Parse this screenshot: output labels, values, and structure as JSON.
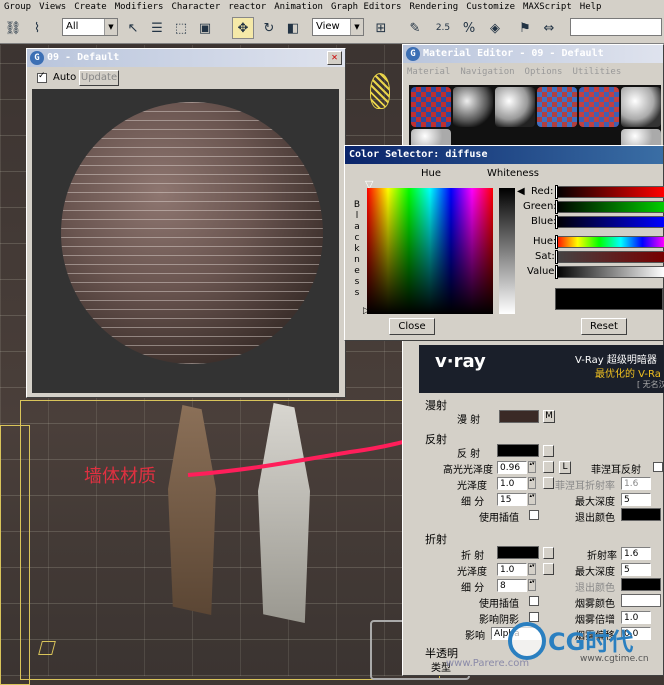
{
  "menubar": {
    "items": [
      "Group",
      "Views",
      "Create",
      "Modifiers",
      "Character",
      "reactor",
      "Animation",
      "Graph Editors",
      "Rendering",
      "Customize",
      "MAXScript",
      "Help"
    ]
  },
  "toolbar": {
    "selection_filter": "All",
    "reference_coord": "View",
    "spinner_value": "2.5"
  },
  "render_window": {
    "title": "09 - Default",
    "auto_label": "Auto",
    "update_label": "Update",
    "auto_checked": true
  },
  "material_editor": {
    "title": "Material Editor - 09 - Default",
    "menu": [
      "Material",
      "Navigation",
      "Options",
      "Utilities"
    ]
  },
  "color_selector": {
    "title": "Color Selector: diffuse",
    "hue_label": "Hue",
    "whiteness_label": "Whiteness",
    "blackness_label": "Blackness",
    "channels": [
      {
        "name": "Red:"
      },
      {
        "name": "Green:"
      },
      {
        "name": "Blue:"
      },
      {
        "name": "Hue:"
      },
      {
        "name": "Sat:"
      },
      {
        "name": "Value:"
      }
    ],
    "close_label": "Close",
    "reset_label": "Reset"
  },
  "vray_banner": {
    "logo": "v·ray",
    "line1": "V-Ray 超级明暗器",
    "line2": "最优化的 V-Ra",
    "line3": "[ 无名汉化"
  },
  "reflection_params": {
    "diffuse_section": "漫射",
    "diffuse_label": "漫 射",
    "m_button": "M",
    "reflect_section": "反射",
    "reflect_label": "反 射",
    "hilight_gloss_label": "高光光泽度",
    "hilight_gloss_value": "0.96",
    "l_button": "L",
    "fresnel_label": "菲涅耳反射",
    "refl_gloss_label": "光泽度",
    "refl_gloss_value": "1.0",
    "fresnel_ior_label": "菲涅耳折射率",
    "fresnel_ior_value": "1.6",
    "subdivs_label": "细 分",
    "subdivs_value": "15",
    "max_depth_label": "最大深度",
    "max_depth_value": "5",
    "use_interp_label": "使用插值",
    "exit_color_label": "退出颜色"
  },
  "refraction_params": {
    "section": "折射",
    "refract_label": "折 射",
    "ior_label": "折射率",
    "ior_value": "1.6",
    "gloss_label": "光泽度",
    "gloss_value": "1.0",
    "max_depth_label": "最大深度",
    "max_depth_value": "5",
    "subdivs_label": "细 分",
    "subdivs_value": "8",
    "exit_color_label": "退出颜色",
    "use_interp_label": "使用插值",
    "fog_color_label": "烟雾颜色",
    "affect_shadows_label": "影响阴影",
    "fog_mult_label": "烟雾倍增",
    "fog_mult_value": "1.0",
    "affect_label": "影响",
    "affect_value": "Alpha",
    "fog_bias_label": "烟雾偏移",
    "fog_bias_value": "0.0"
  },
  "translucency": {
    "section": "半透明",
    "type_label": "类型"
  },
  "annotation": {
    "text": "墙体材质"
  },
  "watermark": {
    "brand": "CG时代",
    "url": "www.cgtime.cn",
    "site": "www.Parere.com"
  }
}
